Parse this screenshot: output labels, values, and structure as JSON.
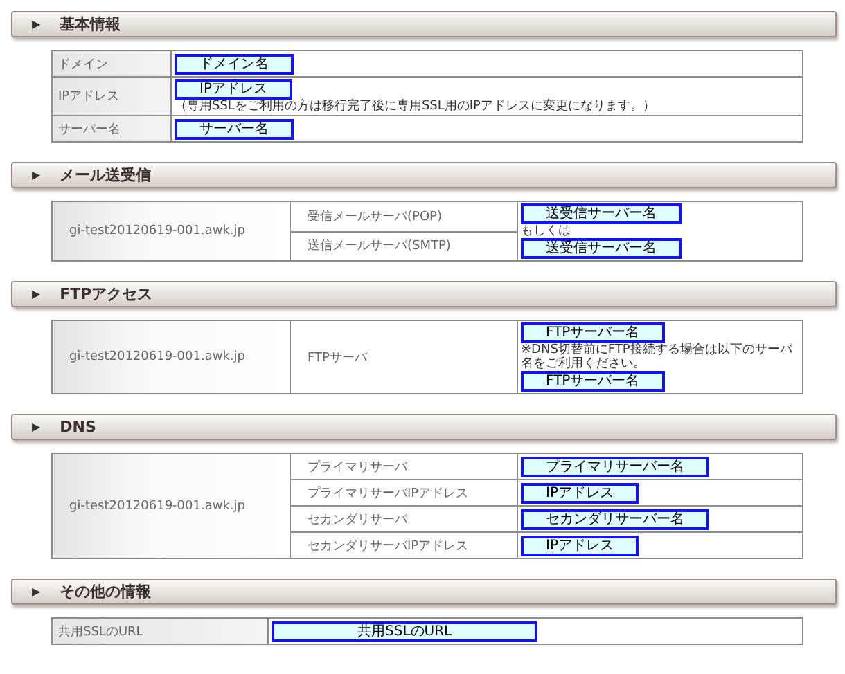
{
  "sections": [
    {
      "marker": "▶",
      "title": "基本情報",
      "kind": "info",
      "rows": [
        {
          "label": "ドメイン",
          "value": "ドメイン名"
        },
        {
          "label": "IPアドレス",
          "value": "IPアドレス",
          "note": "（専用SSLをご利用の方は移行完了後に専用SSL用のIPアドレスに変更になります。）"
        },
        {
          "label": "サーバー名",
          "value": "サーバー名"
        }
      ]
    },
    {
      "marker": "▶",
      "title": "メール送受信",
      "kind": "host_table",
      "host": "gi-test20120619-001.awk.jp",
      "rows": [
        {
          "label": "受信メールサーバ(POP)",
          "cell": [
            {
              "kind": "field",
              "text": "送受信サーバー名"
            },
            {
              "kind": "text",
              "text": "もしくは"
            },
            {
              "kind": "field",
              "text": "送受信サーバー名"
            }
          ]
        },
        {
          "label": "送信メールサーバ(SMTP)"
        }
      ]
    },
    {
      "marker": "▶",
      "title": "FTPアクセス",
      "kind": "host_table",
      "host": "gi-test20120619-001.awk.jp",
      "rows": [
        {
          "label": "FTPサーバ",
          "cell": [
            {
              "kind": "field",
              "text": "FTPサーバー名"
            },
            {
              "kind": "text",
              "text": "※DNS切替前にFTP接続する場合は以下のサーバ名をご利用ください。"
            },
            {
              "kind": "field",
              "text": "FTPサーバー名"
            }
          ]
        }
      ]
    },
    {
      "marker": "▶",
      "title": "DNS",
      "kind": "host_table",
      "host": "gi-test20120619-001.awk.jp",
      "rows": [
        {
          "label": "プライマリサーバ",
          "cell": [
            {
              "kind": "field",
              "text": "プライマリサーバー名"
            }
          ]
        },
        {
          "label": "プライマリサーバIPアドレス",
          "cell": [
            {
              "kind": "field",
              "text": "IPアドレス"
            }
          ]
        },
        {
          "label": "セカンダリサーバ",
          "cell": [
            {
              "kind": "field",
              "text": "セカンダリサーバー名"
            }
          ]
        },
        {
          "label": "セカンダリサーバIPアドレス",
          "cell": [
            {
              "kind": "field",
              "text": "IPアドレス"
            }
          ]
        }
      ]
    },
    {
      "marker": "▶",
      "title": "その他の情報",
      "kind": "url",
      "rows": [
        {
          "label": "共用SSLのURL",
          "value": "共用SSLのURL"
        }
      ]
    }
  ]
}
